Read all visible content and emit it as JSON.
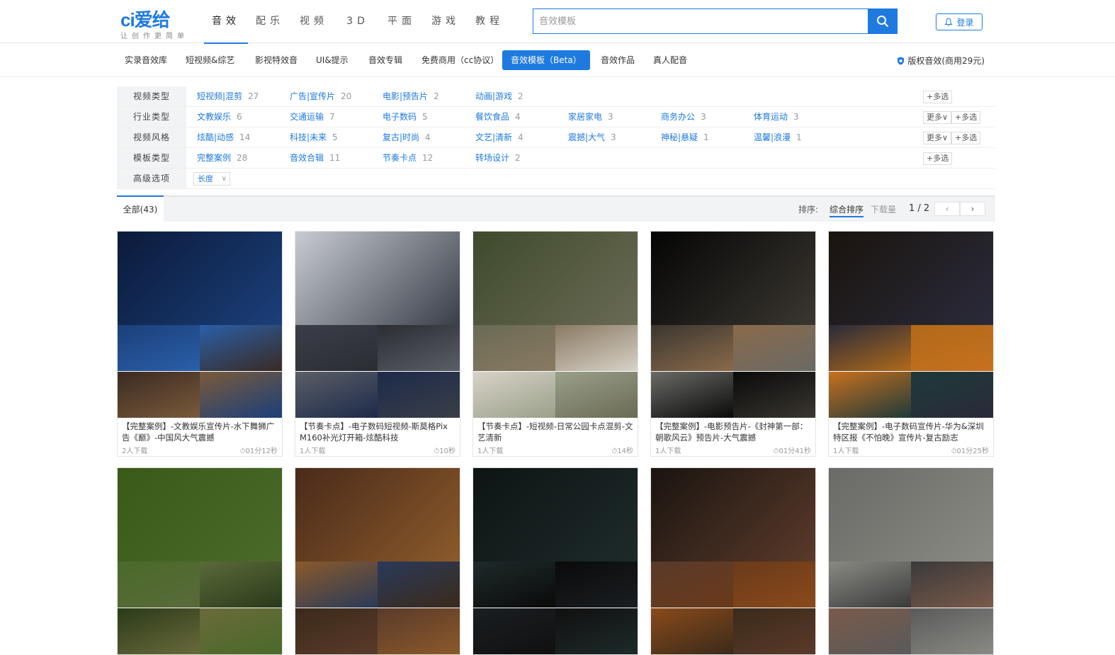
{
  "header": {
    "logo_text": "ci爱给",
    "slogan": "让创作更简单",
    "nav": [
      {
        "label": "音效",
        "active": true
      },
      {
        "label": "配乐",
        "active": false
      },
      {
        "label": "视频",
        "active": false
      },
      {
        "label": "3D",
        "active": false
      },
      {
        "label": "平面",
        "active": false
      },
      {
        "label": "游戏",
        "active": false
      },
      {
        "label": "教程",
        "active": false
      }
    ],
    "search_placeholder": "音效模板",
    "search_icon": "search-icon",
    "login_label": "登录",
    "login_icon": "bell-icon",
    "accent_color": "#1f7ae0"
  },
  "subnav": {
    "items": [
      {
        "label": "实录音效库",
        "active": false
      },
      {
        "label": "短视频&综艺",
        "active": false
      },
      {
        "label": "影视特效音",
        "active": false
      },
      {
        "label": "UI&提示",
        "active": false
      },
      {
        "label": "音效专辑",
        "active": false
      },
      {
        "label": "免费商用（cc协议）",
        "active": false
      },
      {
        "label": "音效模板（Beta）",
        "active": true
      },
      {
        "label": "音效作品",
        "active": false
      },
      {
        "label": "真人配音",
        "active": false
      }
    ],
    "copyright_label": "版权音效(商用29元)",
    "copyright_icon": "shield-icon"
  },
  "filters": {
    "rows": [
      {
        "label": "视频类型",
        "options": [
          {
            "name": "短视频|混剪",
            "count": "27"
          },
          {
            "name": "广告|宣传片",
            "count": "20"
          },
          {
            "name": "电影|预告片",
            "count": "2"
          },
          {
            "name": "动画|游戏",
            "count": "2"
          }
        ],
        "more_label": "",
        "multi_label": "+多选"
      },
      {
        "label": "行业类型",
        "options": [
          {
            "name": "文教娱乐",
            "count": "6"
          },
          {
            "name": "交通运输",
            "count": "7"
          },
          {
            "name": "电子数码",
            "count": "5"
          },
          {
            "name": "餐饮食品",
            "count": "4"
          },
          {
            "name": "家居家电",
            "count": "3"
          },
          {
            "name": "商务办公",
            "count": "3"
          },
          {
            "name": "体育运动",
            "count": "3"
          }
        ],
        "more_label": "更多∨",
        "multi_label": "+多选"
      },
      {
        "label": "视频风格",
        "options": [
          {
            "name": "炫酷|动感",
            "count": "14"
          },
          {
            "name": "科技|未来",
            "count": "5"
          },
          {
            "name": "复古|时尚",
            "count": "4"
          },
          {
            "name": "文艺|清新",
            "count": "4"
          },
          {
            "name": "震撼|大气",
            "count": "3"
          },
          {
            "name": "神秘|悬疑",
            "count": "1"
          },
          {
            "name": "温馨|浪漫",
            "count": "1"
          }
        ],
        "more_label": "更多∨",
        "multi_label": "+多选"
      },
      {
        "label": "模板类型",
        "options": [
          {
            "name": "完整案例",
            "count": "28"
          },
          {
            "name": "音效合辑",
            "count": "11"
          },
          {
            "name": "节奏卡点",
            "count": "12"
          },
          {
            "name": "转场设计",
            "count": "2"
          }
        ],
        "more_label": "",
        "multi_label": "+多选"
      }
    ],
    "advanced_label": "高级选项",
    "length_select": "长度"
  },
  "results": {
    "tab_all": "全部(43)",
    "sort_label": "排序:",
    "sort_options": [
      {
        "label": "综合排序",
        "active": true
      },
      {
        "label": "下载量",
        "active": false
      }
    ],
    "page_text": "1 / 2",
    "prev_label": "‹",
    "next_label": "›"
  },
  "cards": [
    {
      "title": "【完整案例】-文教娱乐宣传片-水下舞狮广告《巅》-中国风大气震撼",
      "downloads": "2人下载",
      "duration": "⏱01分12秒",
      "colors": [
        "#0b1a3a",
        "#1b3f7a",
        "#2a5fa8",
        "#3a2a22",
        "#7a5a3a"
      ]
    },
    {
      "title": "【节奏卡点】-电子数码短视频-斯莫格Pix M160补光灯开箱-炫酷科技",
      "downloads": "1人下载",
      "duration": "⏱10秒",
      "colors": [
        "#c8ccd2",
        "#3a3e48",
        "#2b2d33",
        "#5a5e66",
        "#1d2a4a"
      ]
    },
    {
      "title": "【节奏卡点】-短视频-日常公园卡点混剪-文艺清新",
      "downloads": "1人下载",
      "duration": "⏱14秒",
      "colors": [
        "#3e4a2c",
        "#6a6a54",
        "#8a7a62",
        "#d8d2c8",
        "#9aa08a"
      ]
    },
    {
      "title": "【完整案例】-电影预告片-《封神第一部：朝歌风云》预告片-大气震撼",
      "downloads": "1人下载",
      "duration": "⏱01分41秒",
      "colors": [
        "#050505",
        "#3a3630",
        "#8a6a4a",
        "#6a6a66",
        "#0a0a0a"
      ]
    },
    {
      "title": "【完整案例】-电子数码宣传片-华为&深圳特区报《不怕晚》宣传片-复古励志",
      "downloads": "1人下载",
      "duration": "⏱01分25秒",
      "colors": [
        "#1a140e",
        "#2a2a3a",
        "#b06a1a",
        "#c8701e",
        "#1e3a3a"
      ]
    },
    {
      "title": "",
      "downloads": "",
      "duration": "",
      "colors": [
        "#3a5a1a",
        "#4a6a2a",
        "#5a6a3a",
        "#2a3a1a",
        "#6a6a3a"
      ]
    },
    {
      "title": "",
      "downloads": "",
      "duration": "",
      "colors": [
        "#4a2a1a",
        "#8a5a2a",
        "#2a3a5a",
        "#3a2a1a",
        "#5a3a2a"
      ]
    },
    {
      "title": "",
      "downloads": "",
      "duration": "",
      "colors": [
        "#0e1414",
        "#1e2a2a",
        "#0a0a0a",
        "#1a1e22",
        "#101010"
      ]
    },
    {
      "title": "",
      "downloads": "",
      "duration": "",
      "colors": [
        "#1a1410",
        "#5a3a2a",
        "#6a3a1a",
        "#8a4a1a",
        "#3a2a1a"
      ]
    },
    {
      "title": "",
      "downloads": "",
      "duration": "",
      "colors": [
        "#6a6a66",
        "#8a8a84",
        "#3a3a3a",
        "#7a5a4a",
        "#5a5a5a"
      ]
    }
  ]
}
